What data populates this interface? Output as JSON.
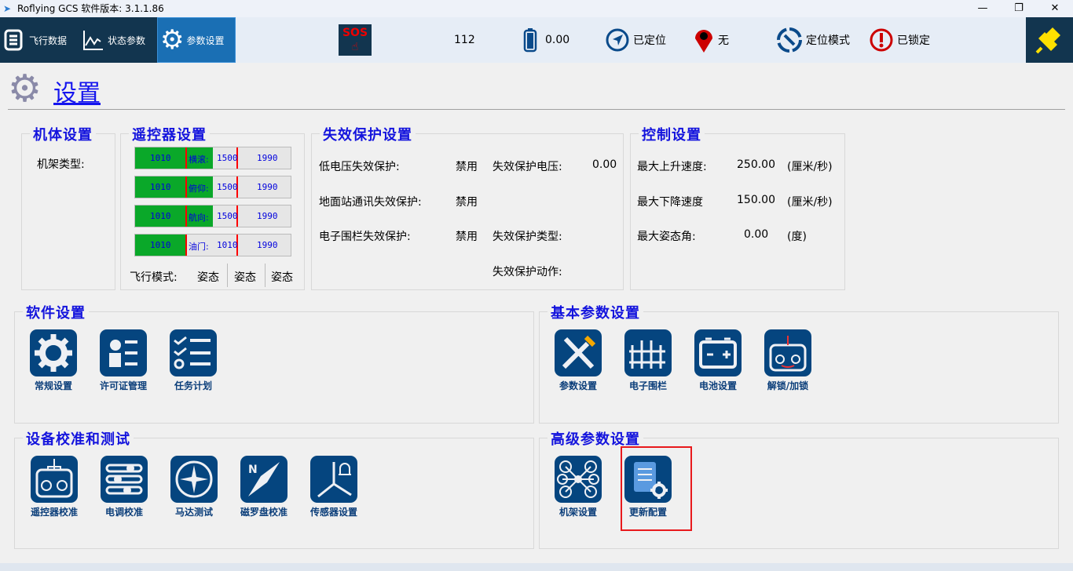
{
  "window": {
    "title": "Roflying GCS 软件版本: 3.1.1.86",
    "minimize": "—",
    "restore": "❐",
    "close": "✕"
  },
  "toolbar": {
    "tabs": [
      {
        "label": "飞行数据"
      },
      {
        "label": "状态参数"
      },
      {
        "label": "参数设置"
      }
    ],
    "sos": "SOS",
    "value": "112",
    "battery": "0.00",
    "gps": "已定位",
    "location": "无",
    "mode": "定位模式",
    "lock": "已锁定"
  },
  "page": {
    "title": "设置"
  },
  "airframe": {
    "title": "机体设置",
    "frame_label": "机架类型:"
  },
  "rc": {
    "title": "遥控器设置",
    "channels": [
      {
        "min": "1010",
        "label": "横滚:",
        "value": "1500",
        "max": "1990",
        "fill_pct": 50
      },
      {
        "min": "1010",
        "label": "俯仰:",
        "value": "1500",
        "max": "1990",
        "fill_pct": 50
      },
      {
        "min": "1010",
        "label": "航向:",
        "value": "1500",
        "max": "1990",
        "fill_pct": 50
      },
      {
        "min": "1010",
        "label": "油门:",
        "value": "1010",
        "max": "1990",
        "fill_pct": 33
      }
    ],
    "mode_label": "飞行模式:",
    "modes": [
      "姿态",
      "姿态",
      "姿态"
    ]
  },
  "failsafe": {
    "title": "失效保护设置",
    "low_voltage": "低电压失效保护:",
    "low_voltage_val": "禁用",
    "voltage": "失效保护电压:",
    "voltage_val": "0.00",
    "gcs": "地面站通讯失效保护:",
    "gcs_val": "禁用",
    "fence": "电子围栏失效保护:",
    "fence_val": "禁用",
    "type": "失效保护类型:",
    "action": "失效保护动作:"
  },
  "control": {
    "title": "控制设置",
    "rows": [
      {
        "label": "最大上升速度:",
        "value": "250.00",
        "unit": "(厘米/秒)"
      },
      {
        "label": "最大下降速度",
        "value": "150.00",
        "unit": "(厘米/秒)"
      },
      {
        "label": "最大姿态角:",
        "value": "0.00",
        "unit": "(度)"
      }
    ]
  },
  "software": {
    "title": "软件设置",
    "items": [
      "常规设置",
      "许可证管理",
      "任务计划"
    ]
  },
  "basic": {
    "title": "基本参数设置",
    "items": [
      "参数设置",
      "电子围栏",
      "电池设置",
      "解锁/加锁"
    ]
  },
  "calib": {
    "title": "设备校准和测试",
    "items": [
      "遥控器校准",
      "电调校准",
      "马达测试",
      "磁罗盘校准",
      "传感器设置"
    ]
  },
  "advanced": {
    "title": "高级参数设置",
    "items": [
      "机架设置",
      "更新配置"
    ]
  },
  "colors": {
    "accent": "#1a6fb4",
    "nav": "#12354f",
    "tile": "#05457f",
    "highlight": "#e8191c"
  }
}
